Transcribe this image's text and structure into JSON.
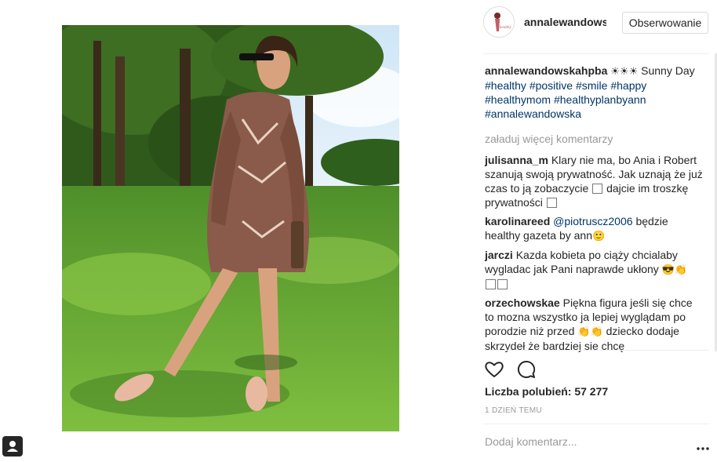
{
  "post": {
    "author": "annalewandowskahpba",
    "follow_label": "Obserwowanie",
    "caption": {
      "username": "annalewandowskahpba",
      "sun": "☀☀☀",
      "text": "Sunny Day",
      "hashtags": [
        "#healthy",
        "#positive",
        "#smile",
        "#happy",
        "#healthymom",
        "#healthyplanbyann",
        "#annalewandowska"
      ]
    },
    "load_more": "załaduj więcej komentarzy",
    "comments": [
      {
        "username": "julisanna_m",
        "part1": "Klary nie ma, bo Ania i Robert szanują swoją prywatność. Jak uznają że już czas to ją zobaczycie",
        "part2": "dajcie im troszkę prywatności"
      },
      {
        "username": "karolinareed",
        "mention": "@piotruscz2006",
        "text": "będzie healthy gazeta by ann",
        "emoji": "🙂"
      },
      {
        "username": "jarczi",
        "text": "Kazda kobieta po ciąży chcialaby wygladac jak Pani naprawde ukłony",
        "emoji": "😎👏"
      },
      {
        "username": "orzechowskae",
        "part1": "Piękna figura jeśli się chce to mozna wszystko ja lepiej wyglądam po porodzie niż przed",
        "emoji": "👏👏",
        "part2": "dziecko dodaje skrzydeł że bardziej sie chcę"
      }
    ],
    "likes_text": "Liczba polubień: 57 277",
    "date": "1 DZIEŃ TEMU",
    "add_comment_placeholder": "Dodaj komentarz..."
  },
  "icons": {
    "heart": "heart-icon",
    "comment": "comment-icon",
    "more": "more-icon",
    "user_tag": "user-tag-icon"
  },
  "colors": {
    "hashtag": "#003569",
    "muted": "#999999",
    "text": "#262626",
    "border": "#dbdbdb"
  }
}
